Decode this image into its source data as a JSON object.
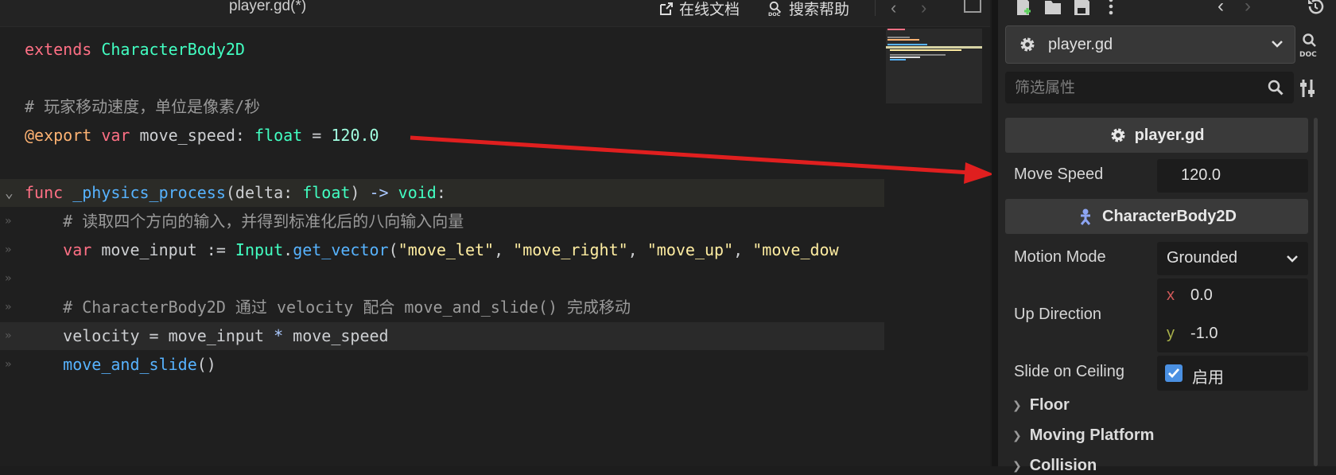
{
  "editor": {
    "file_title": "player.gd(*)",
    "online_docs": "在线文档",
    "search_help": "搜索帮助",
    "nav_back": "‹",
    "nav_forward": "›"
  },
  "code": [
    {
      "tokens": [
        [
          "k",
          "extends"
        ],
        [
          "n",
          " "
        ],
        [
          "t",
          "CharacterBody2D"
        ]
      ]
    },
    {
      "tokens": []
    },
    {
      "tokens": [
        [
          "c",
          "# 玩家移动速度，单位是像素/秒"
        ]
      ]
    },
    {
      "tokens": [
        [
          "a",
          "@export"
        ],
        [
          "n",
          " "
        ],
        [
          "k",
          "var"
        ],
        [
          "n",
          " move_speed: "
        ],
        [
          "t",
          "float"
        ],
        [
          "n",
          " = "
        ],
        [
          "num",
          "120.0"
        ]
      ]
    },
    {
      "tokens": []
    },
    {
      "tokens": [
        [
          "k",
          "func"
        ],
        [
          "n",
          " "
        ],
        [
          "f",
          "_physics_process"
        ],
        [
          "n",
          "(delta: "
        ],
        [
          "t",
          "float"
        ],
        [
          "n",
          ") "
        ],
        [
          "op",
          "->"
        ],
        [
          "n",
          " "
        ],
        [
          "t",
          "void"
        ],
        [
          "n",
          ":"
        ]
      ]
    },
    {
      "tokens": [
        [
          "n",
          "    "
        ],
        [
          "c",
          "# 读取四个方向的输入，并得到标准化后的八向输入向量"
        ]
      ]
    },
    {
      "tokens": [
        [
          "n",
          "    "
        ],
        [
          "k",
          "var"
        ],
        [
          "n",
          " move_input := "
        ],
        [
          "t",
          "Input"
        ],
        [
          "n",
          "."
        ],
        [
          "f",
          "get_vector"
        ],
        [
          "n",
          "("
        ],
        [
          "s",
          "\"move_let\""
        ],
        [
          "n",
          ", "
        ],
        [
          "s",
          "\"move_right\""
        ],
        [
          "n",
          ", "
        ],
        [
          "s",
          "\"move_up\""
        ],
        [
          "n",
          ", "
        ],
        [
          "s",
          "\"move_dow"
        ]
      ]
    },
    {
      "tokens": []
    },
    {
      "tokens": [
        [
          "n",
          "    "
        ],
        [
          "c",
          "# CharacterBody2D 通过 velocity 配合 move_and_slide() 完成移动"
        ]
      ]
    },
    {
      "tokens": [
        [
          "n",
          "    velocity = move_input "
        ],
        [
          "op",
          "*"
        ],
        [
          "n",
          " move_speed"
        ]
      ]
    },
    {
      "tokens": [
        [
          "n",
          "    "
        ],
        [
          "f",
          "move_and_slide"
        ],
        [
          "n",
          "()"
        ]
      ]
    }
  ],
  "inspector": {
    "resource_name": "player.gd",
    "filter_placeholder": "筛选属性",
    "script_section": "player.gd",
    "move_speed_label": "Move Speed",
    "move_speed_value": "120.0",
    "class_section": "CharacterBody2D",
    "motion_mode_label": "Motion Mode",
    "motion_mode_value": "Grounded",
    "up_direction_label": "Up Direction",
    "up_x_label": "x",
    "up_x_value": "0.0",
    "up_y_label": "y",
    "up_y_value": "-1.0",
    "slide_label": "Slide on Ceiling",
    "slide_checked": true,
    "slide_value": "启用",
    "groups": [
      "Floor",
      "Moving Platform",
      "Collision"
    ]
  },
  "colors": {
    "keyword": "#ff7085",
    "type": "#42ffc2",
    "comment": "#9a9a9a",
    "annotation": "#ffb373",
    "function": "#57b3ff",
    "string": "#ffeda1",
    "arrow": "#e01f1f",
    "checkbox": "#4a90e2"
  }
}
